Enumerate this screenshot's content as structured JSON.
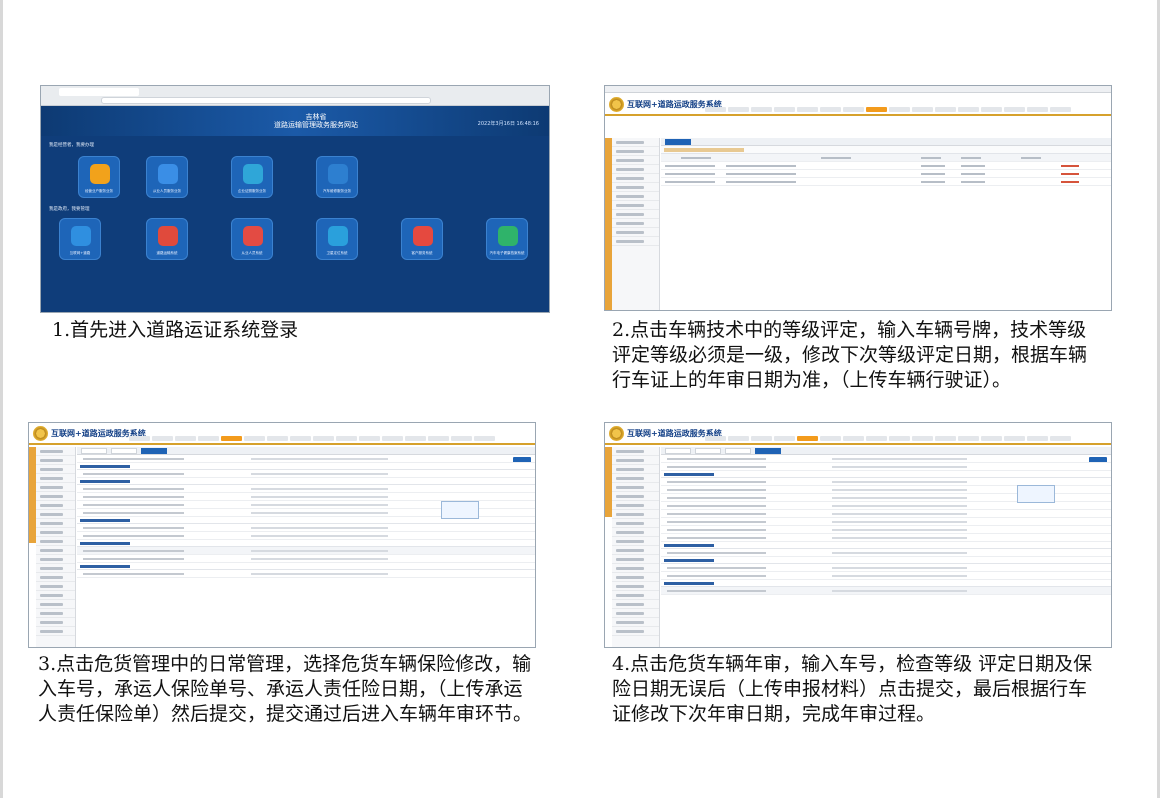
{
  "screens": {
    "portal": {
      "title_line1": "吉林省",
      "title_line2": "道路运输管理政务服务网站",
      "clock": "2022年3月16日 16:48:16",
      "section1": "我是经营者，我要办理",
      "section2": "我是政府，我要管理",
      "tiles_row1": [
        "经营业户服务业务",
        "从业人员服务业务",
        "企业证照服务业务",
        "汽车维修服务业务"
      ],
      "tiles_row2": [
        "互联网+道路",
        "道路运输系统",
        "从业人员系统",
        "卫星定位系统",
        "客户服务系统",
        "汽车电子健康档案系统"
      ]
    },
    "system": {
      "title": "互联网+道路运政服务系统"
    }
  },
  "captions": {
    "step1": "1.首先进入道路运证系统登录",
    "step2": "2.点击车辆技术中的等级评定，输入车辆号牌，技术等级评定等级必须是一级，修改下次等级评定日期，根据车辆行车证上的年审日期为准，（上传车辆行驶证）。",
    "step3": "3.点击危货管理中的日常管理，选择危货车辆保险修改，输入车号，承运人保险单号、承运人责任险日期，（上传承运人责任保险单）然后提交，提交通过后进入车辆年审环节。",
    "step4": "4.点击危货车辆年审，输入车号，检查等级 评定日期及保险日期无误后（上传申报材料）点击提交，最后根据行车证修改下次年审日期，完成年审过程。"
  },
  "colors": {
    "portal_bg": "#0f3d7a",
    "system_title": "#123f86",
    "menu_active": "#f39b1c",
    "sidebar_accent": "#e8a43a"
  }
}
